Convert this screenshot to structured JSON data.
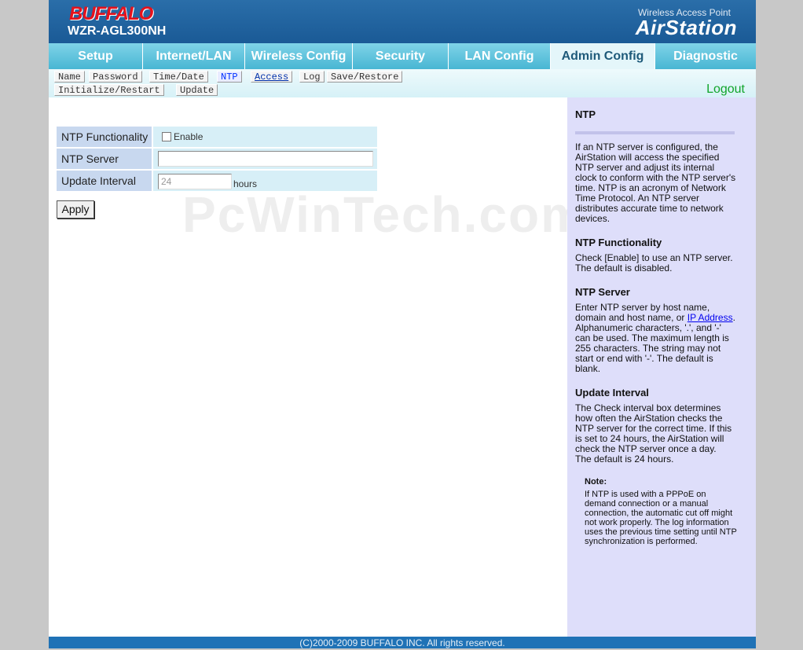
{
  "header": {
    "brand": "BUFFALO",
    "model": "WZR-AGL300NH",
    "product_subtitle": "Wireless Access Point",
    "product_name": "AirStation"
  },
  "tabs": [
    {
      "label": "Setup",
      "active": false
    },
    {
      "label": "Internet/LAN",
      "active": false
    },
    {
      "label": "Wireless Config",
      "active": false
    },
    {
      "label": "Security",
      "active": false
    },
    {
      "label": "LAN Config",
      "active": false
    },
    {
      "label": "Admin Config",
      "active": true
    },
    {
      "label": "Diagnostic",
      "active": false
    }
  ],
  "subnav": {
    "items": [
      "Name",
      "Password",
      "Time/Date",
      "NTP",
      "Access",
      "Log",
      "Save/Restore",
      "Initialize/Restart",
      "Update"
    ],
    "current": "NTP",
    "logout": "Logout"
  },
  "form": {
    "ntp_functionality_label": "NTP Functionality",
    "enable_label": "Enable",
    "enable_checked": false,
    "ntp_server_label": "NTP Server",
    "ntp_server_value": "",
    "update_interval_label": "Update Interval",
    "update_interval_value": "24",
    "update_interval_unit": "hours",
    "apply_label": "Apply"
  },
  "watermark": "PcWinTech.com",
  "help": {
    "title": "NTP",
    "intro": "If an NTP server is configured, the AirStation will access the specified NTP server and adjust its internal clock to conform with the NTP server's time. NTP is an acronym of Network Time Protocol. An NTP server distributes accurate time to network devices.",
    "functionality_title": "NTP Functionality",
    "functionality_text_1": "Check [Enable] to use an NTP server.",
    "functionality_text_2": "The default is disabled.",
    "server_title": "NTP Server",
    "server_text_a": "Enter NTP server by host name, domain and host name, or",
    "server_link": "IP Address",
    "server_text_b": ". Alphanumeric characters, '.', and '-' can be used. The maximum length is 255 characters. The string may not start or end with '-'. The default is blank.",
    "interval_title": "Update Interval",
    "interval_text_1": "The Check interval box determines how often the AirStation checks the NTP server for the correct time. If this is set to 24 hours, the AirStation will check the NTP server once a day.",
    "interval_text_2": "The default is 24 hours.",
    "note_title": "Note:",
    "note_text": "If NTP is used with a PPPoE on demand connection or a manual connection, the automatic cut off might not work properly. The log information uses the previous time setting until NTP synchronization is performed."
  },
  "footer": {
    "copyright": "(C)2000-2009 BUFFALO INC. All rights reserved."
  }
}
